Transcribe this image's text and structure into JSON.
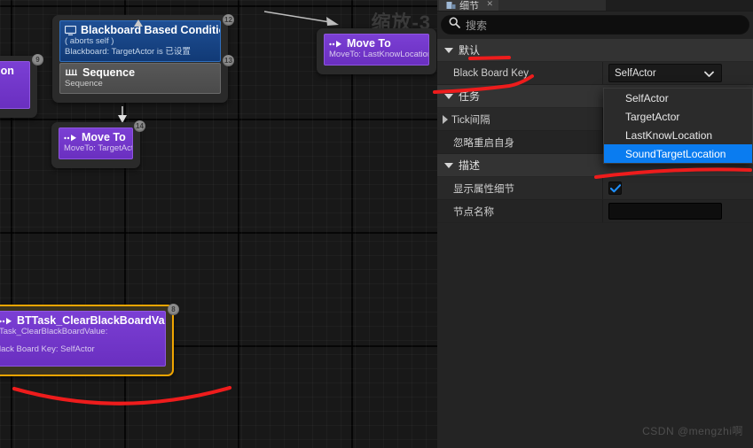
{
  "graph": {
    "zoom_label": "缩放-3",
    "nodes": [
      {
        "id": "left-partial",
        "kind": "task",
        "title": "ation",
        "subtitle": "",
        "index": "9"
      },
      {
        "id": "blackboard-condition",
        "kind": "composite-with-decorator",
        "decorator": {
          "title": "Blackboard Based Condition",
          "line1": "( aborts self )",
          "line2": "Blackboard: TargetActor is 已设置",
          "icon": "monitor-icon"
        },
        "composite": {
          "title": "Sequence",
          "subtitle": "Sequence",
          "icon": "sequence-icon"
        },
        "index_top": "12",
        "index_side": "13"
      },
      {
        "id": "move-to-target",
        "kind": "task",
        "title": "Move To",
        "subtitle": "MoveTo: TargetActor",
        "icon": "move-to-icon",
        "index": "14"
      },
      {
        "id": "move-to-lastknown",
        "kind": "task",
        "title": "Move To",
        "subtitle": "MoveTo: LastKnowLocation",
        "icon": "move-to-icon",
        "index": ""
      },
      {
        "id": "bttask-clear",
        "kind": "task-selected",
        "title": "BTTask_ClearBlackBoardValue",
        "line1": "Task_ClearBlackBoardValue:",
        "line2": "lack Board Key: SelfActor",
        "icon": "move-to-icon",
        "index": "8"
      }
    ]
  },
  "details": {
    "tab_label": "细节",
    "tab_close": "✕",
    "search": {
      "placeholder": "搜索",
      "value": "",
      "icon": "search-icon"
    },
    "categories": [
      {
        "label": "默认",
        "expanded": true
      },
      {
        "label": "任务",
        "expanded": true
      },
      {
        "label": "描述",
        "expanded": true
      }
    ],
    "rows": {
      "black_board_key": {
        "label": "Black Board Key",
        "value": "SelfActor",
        "chevron": "chevron-down-icon"
      },
      "tick_interval": {
        "label": "Tick间隔",
        "expandable": true
      },
      "ignore_restart_self": {
        "label": "忽略重启自身"
      },
      "show_property_details": {
        "label": "显示属性细节",
        "checked": true,
        "check_glyph": "✓"
      },
      "node_name": {
        "label": "节点名称",
        "value": ""
      }
    },
    "dropdown": {
      "open": true,
      "options": [
        "SelfActor",
        "TargetActor",
        "LastKnowLocation",
        "SoundTargetLocation"
      ],
      "selected": "SoundTargetLocation",
      "selected_index": 3,
      "highlight_color": "#0a7cf0"
    }
  },
  "annotations": {
    "color": "#ee1c1c",
    "marks": [
      "underline-default-category",
      "arrow-to-black-board-key",
      "underline-sound-target-location",
      "underline-bottom-node"
    ]
  },
  "watermark": "CSDN @mengzhi啊"
}
